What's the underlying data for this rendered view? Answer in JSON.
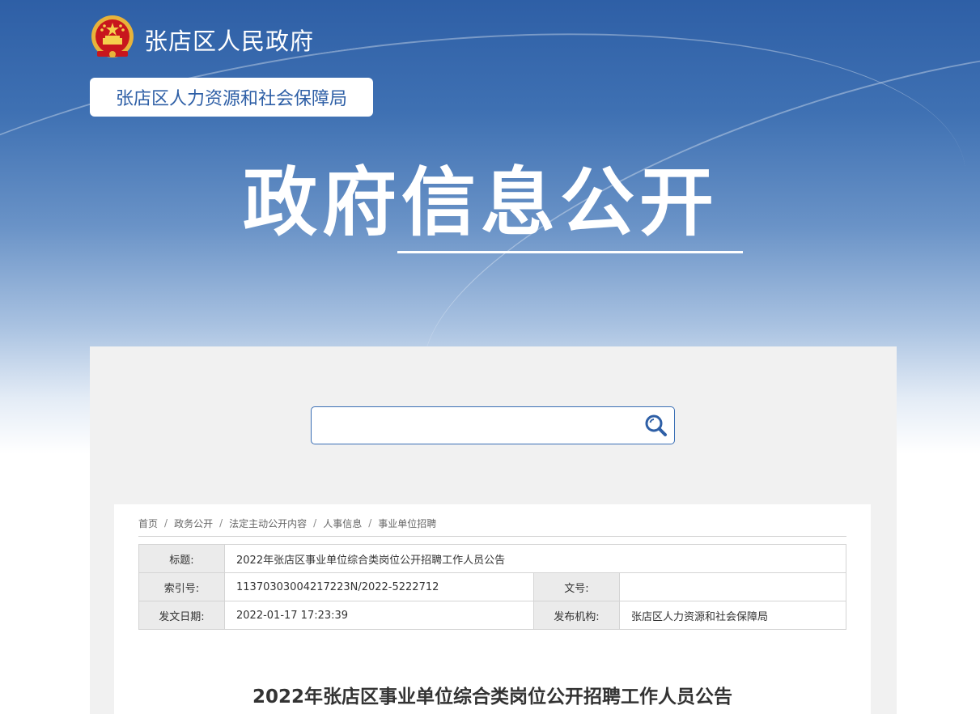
{
  "header": {
    "site_name": "张店区人民政府",
    "department": "张店区人力资源和社会保障局",
    "banner_title": "政府信息公开"
  },
  "search": {
    "value": "",
    "placeholder": ""
  },
  "breadcrumb": [
    "首页",
    "政务公开",
    "法定主动公开内容",
    "人事信息",
    "事业单位招聘"
  ],
  "info": {
    "title_label": "标题:",
    "title_value": "2022年张店区事业单位综合类岗位公开招聘工作人员公告",
    "index_label": "索引号:",
    "index_value": "11370303004217223N/2022-5222712",
    "docno_label": "文号:",
    "docno_value": "",
    "date_label": "发文日期:",
    "date_value": "2022-01-17 17:23:39",
    "org_label": "发布机构:",
    "org_value": "张店区人力资源和社会保障局"
  },
  "article": {
    "title": "2022年张店区事业单位综合类岗位公开招聘工作人员公告"
  },
  "colors": {
    "brand_blue": "#2e5fa6",
    "panel_bg": "#f1f1f1",
    "label_bg": "#ebebeb"
  },
  "icons": {
    "emblem": "national-emblem-icon",
    "search": "search-icon"
  }
}
